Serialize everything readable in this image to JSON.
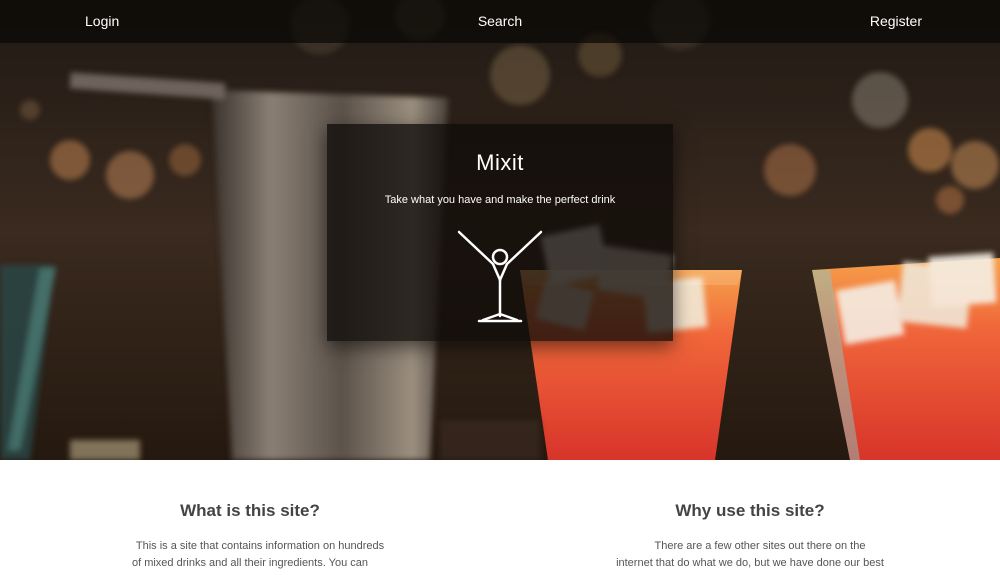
{
  "nav": {
    "login": "Login",
    "search": "Search",
    "register": "Register"
  },
  "hero": {
    "title": "Mixit",
    "tagline": "Take what you have and make the perfect drink",
    "logo_icon": "cocktail-glass-figure-icon"
  },
  "sections": {
    "about": {
      "heading": "What is this site?",
      "body": "This is a site that contains information on hundreds of mixed drinks and all their ingredients. You can search this database of information for all the drinks"
    },
    "why": {
      "heading": "Why use this site?",
      "body": "There are a few other sites out there on the internet that do what we do, but we have done our best to run this site quickly, beautifully and make something"
    }
  },
  "colors": {
    "panel": "#100c09",
    "heading": "#444444",
    "body_text": "#555555",
    "drink": "#e8432a"
  }
}
